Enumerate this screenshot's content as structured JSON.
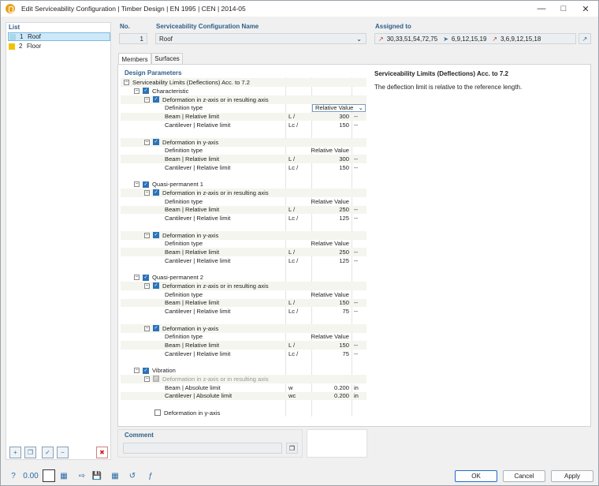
{
  "window": {
    "title": "Edit Serviceability Configuration | Timber Design | EN 1995 | CEN | 2014-05"
  },
  "list": {
    "label": "List",
    "items": [
      {
        "number": "1",
        "name": "Roof",
        "color": "#a8d8ea"
      },
      {
        "number": "2",
        "name": "Floor",
        "color": "#f2c200"
      }
    ]
  },
  "no": {
    "label": "No.",
    "value": "1"
  },
  "config_name": {
    "label": "Serviceability Configuration Name",
    "value": "Roof"
  },
  "assigned": {
    "label": "Assigned to",
    "members": "30,33,51,54,72,75",
    "sets": "6,9,12,15,19",
    "other": "3,6,9,12,15,18"
  },
  "tabs": [
    "Members",
    "Surfaces"
  ],
  "design_params": {
    "label": "Design Parameters",
    "root": "Serviceability Limits (Deflections) Acc. to 7.2",
    "groups": [
      {
        "name": "Characteristic",
        "z_title": "Deformation in z-axis or in resulting axis",
        "y_title": "Deformation in y-axis",
        "def_label": "Definition type",
        "def_value": "Relative Value",
        "beam_label": "Beam | Relative limit",
        "cant_label": "Cantilever | Relative limit",
        "z_beam": "300",
        "z_cant": "150",
        "y_beam": "300",
        "y_cant": "150"
      },
      {
        "name": "Quasi-permanent 1",
        "z_title": "Deformation in z-axis or in resulting axis",
        "y_title": "Deformation in y-axis",
        "def_label": "Definition type",
        "def_value": "Relative Value",
        "beam_label": "Beam | Relative limit",
        "cant_label": "Cantilever | Relative limit",
        "z_beam": "250",
        "z_cant": "125",
        "y_beam": "250",
        "y_cant": "125"
      },
      {
        "name": "Quasi-permanent 2",
        "z_title": "Deformation in z-axis or in resulting axis",
        "y_title": "Deformation in y-axis",
        "def_label": "Definition type",
        "def_value": "Relative Value",
        "beam_label": "Beam | Relative limit",
        "cant_label": "Cantilever | Relative limit",
        "z_beam": "150",
        "z_cant": "75",
        "y_beam": "150",
        "y_cant": "75"
      }
    ],
    "sym_beam": "L /",
    "sym_cant": "Lc /",
    "dash": "--",
    "vibration": {
      "name": "Vibration",
      "z_title": "Deformation in z-axis or in resulting axis",
      "beam_label": "Beam | Absolute limit",
      "beam_sym": "w",
      "beam_value": "0.200",
      "beam_unit": "in",
      "cant_label": "Cantilever | Absolute limit",
      "cant_sym": "wc",
      "cant_value": "0.200",
      "cant_unit": "in",
      "y_title": "Deformation in y-axis"
    }
  },
  "info": {
    "title": "Serviceability Limits (Deflections) Acc. to 7.2",
    "text": "The deflection limit is relative to the reference length."
  },
  "comment": {
    "label": "Comment",
    "value": ""
  },
  "buttons": {
    "ok": "OK",
    "cancel": "Cancel",
    "apply": "Apply"
  },
  "colors": {
    "accent": "#2b73b8",
    "label": "#2f5f8a"
  }
}
